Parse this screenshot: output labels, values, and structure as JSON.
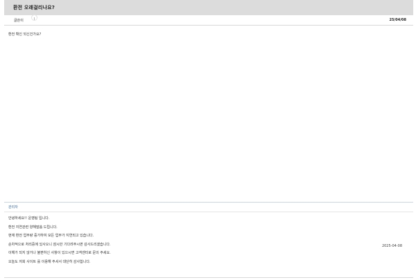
{
  "post": {
    "title": "환전 오래걸리나요?",
    "author": "글쓴이",
    "date": "25/04/08",
    "body": "환전 확인 되신건가요?"
  },
  "reply": {
    "author": "관리자",
    "date": "2025-04-08",
    "lines": [
      "안녕하세요!! 운영팀 입니다.",
      "환전 지연관련 양해말씀 드립니다.",
      "현재 환전 업무량 증가하여 모든 업무가 지연되고 있습니다.",
      "순차적으로 처리중에 있사오니 잠시만 기다려주시면 감사드리겠습니다.",
      "이해가 되지 않거나 불편하신 사항이 있으시면 고객센터로 문의 주세요.",
      "오늘도 저희 사이트 를 이용해 주셔서 대단히 감사합니다."
    ]
  }
}
